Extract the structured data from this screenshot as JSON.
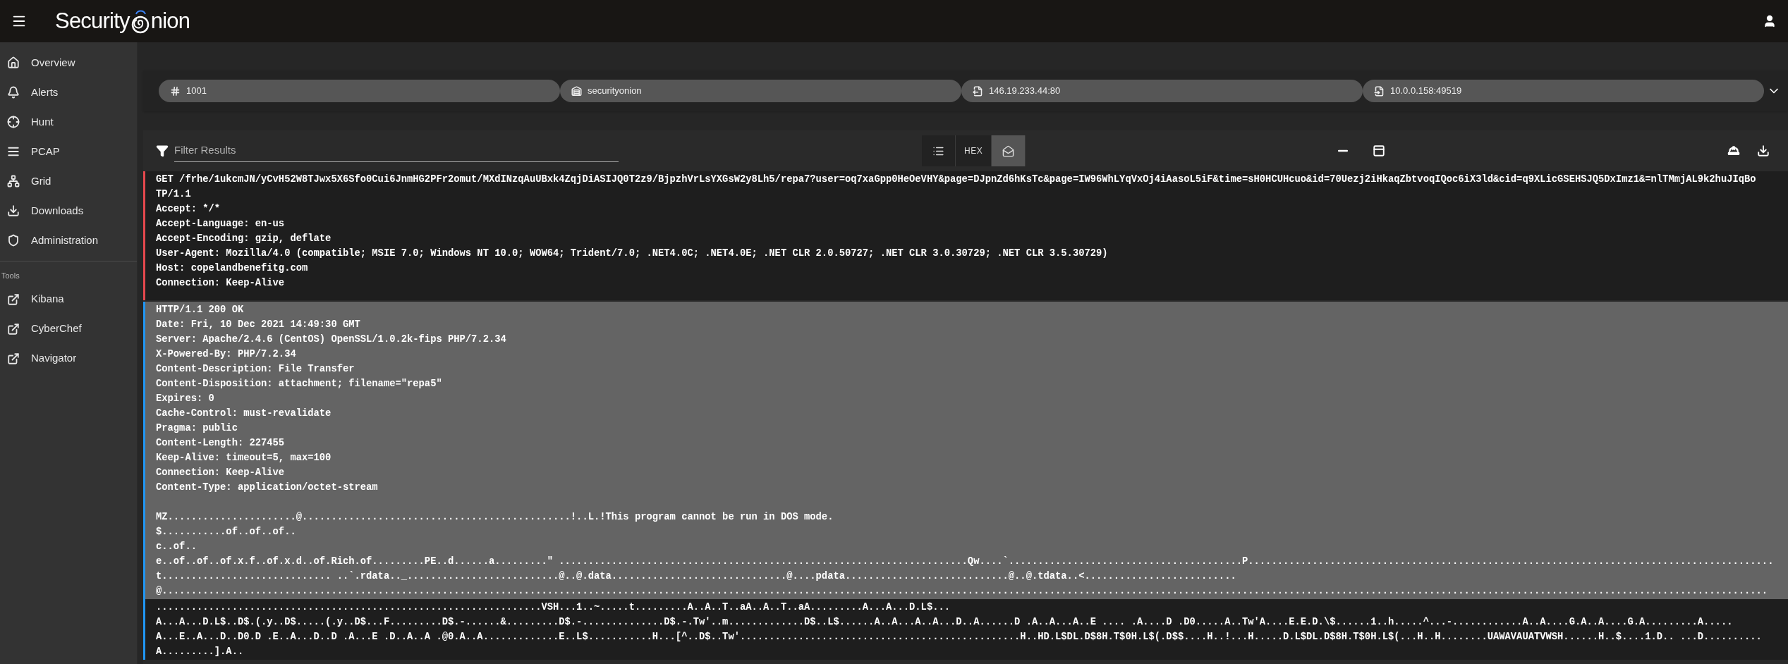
{
  "topbar": {
    "logo_start": "Security",
    "logo_end": "nion"
  },
  "sidebar": {
    "items": [
      {
        "label": "Overview"
      },
      {
        "label": "Alerts"
      },
      {
        "label": "Hunt"
      },
      {
        "label": "PCAP"
      },
      {
        "label": "Grid"
      },
      {
        "label": "Downloads"
      },
      {
        "label": "Administration"
      }
    ],
    "section_title": "Tools",
    "tools": [
      {
        "label": "Kibana"
      },
      {
        "label": "CyberChef"
      },
      {
        "label": "Navigator"
      }
    ]
  },
  "chips": [
    {
      "label": "1001"
    },
    {
      "label": "securityonion"
    },
    {
      "label": "146.19.233.44:80"
    },
    {
      "label": "10.0.0.158:49519"
    }
  ],
  "toolbar": {
    "filter_placeholder": "Filter Results",
    "view_modes": [
      {
        "kind": "icon",
        "selected": false
      },
      {
        "kind": "text",
        "label": "HEX",
        "selected": false
      },
      {
        "kind": "icon",
        "selected": true
      }
    ]
  },
  "streams": [
    {
      "kind": "request",
      "highlighted": false,
      "lines": [
        "GET /frhe/1ukcmJN/yCvH52W8TJwx5X6Sfo0Cui6JnmHG2PFr2omut/MXdINzqAuUBxk4ZqjDiASIJQ0T2z9/BjpzhVrLsYXGsW2y8Lh5/repa7?user=oq7xaGpp0HeOeVHY&page=DJpnZd6hKsTc&page=IW96WhLYqVxOj4iAasoL5iF&time=sH0HCUHcuo&id=70Uezj2iHkaqZbtvoqIQoc6iX3ld&cid=q9XLicGSEHSJQ5DxImz1&=nlTMmjAL9k2huJIqBo",
        "TP/1.1",
        "Accept: */*",
        "Accept-Language: en-us",
        "Accept-Encoding: gzip, deflate",
        "User-Agent: Mozilla/4.0 (compatible; MSIE 7.0; Windows NT 10.0; WOW64; Trident/7.0; .NET4.0C; .NET4.0E; .NET CLR 2.0.50727; .NET CLR 3.0.30729; .NET CLR 3.5.30729)",
        "Host: copelandbenefitg.com",
        "Connection: Keep-Alive"
      ]
    },
    {
      "kind": "response",
      "highlighted": true,
      "lines": [
        "HTTP/1.1 200 OK",
        "Date: Fri, 10 Dec 2021 14:49:30 GMT",
        "Server: Apache/2.4.6 (CentOS) OpenSSL/1.0.2k-fips PHP/7.2.34",
        "X-Powered-By: PHP/7.2.34",
        "Content-Description: File Transfer",
        "Content-Disposition: attachment; filename=\"repa5\"",
        "Expires: 0",
        "Cache-Control: must-revalidate",
        "Pragma: public",
        "Content-Length: 227455",
        "Keep-Alive: timeout=5, max=100",
        "Connection: Keep-Alive",
        "Content-Type: application/octet-stream"
      ],
      "body_lines": [
        "MZ......................@..............................................!..L.!This program cannot be run in DOS mode.",
        "$...........of..of..of..",
        "c..of..",
        "e..of..of..of.x.f..of.x.d..of.Rich.of.........PE..d......a.........\" ......................................................................Qw....`........................................P..........................................................................................",
        "t............................. ..`.rdata.._..........................@..@.data..............................@....pdata............................@..@.tdata..<..........................",
        "@..................................................................................................................................................................................................................................................................................."
      ]
    },
    {
      "kind": "response",
      "highlighted": false,
      "lines": [
        "..................................................................VSH...1..~.....t.........A..A..T..aA..A..T..aA.........A...A...D.L$...",
        "A...A...D.L$..D$.(.y..D$.....(.y..D$...F.........D$.-......&.........D$.-..............D$.-.Tw'..m.............D$..L$......A..A...A..A...D..A......D .A..A...A..E .... .A....D .D0.....A..Tw'A....E.E.D.\\$......1..h.....^...-............A..A....G.A..A....G.A.........A.....",
        "A...E..A...D..D0.D .E..A...D..D .A...E .D..A..A .@0.A..A.............E..L$...........H...[^..D$..Tw'................................................H..HD.L$DL.D$8H.T$0H.L$(.D$$....H..!...H.....D.L$DL.D$8H.T$0H.L$(...H..H........UAWAVAUATVWSH......H..$....1.D.. ...D..........",
        "A.........].A.."
      ]
    }
  ]
}
